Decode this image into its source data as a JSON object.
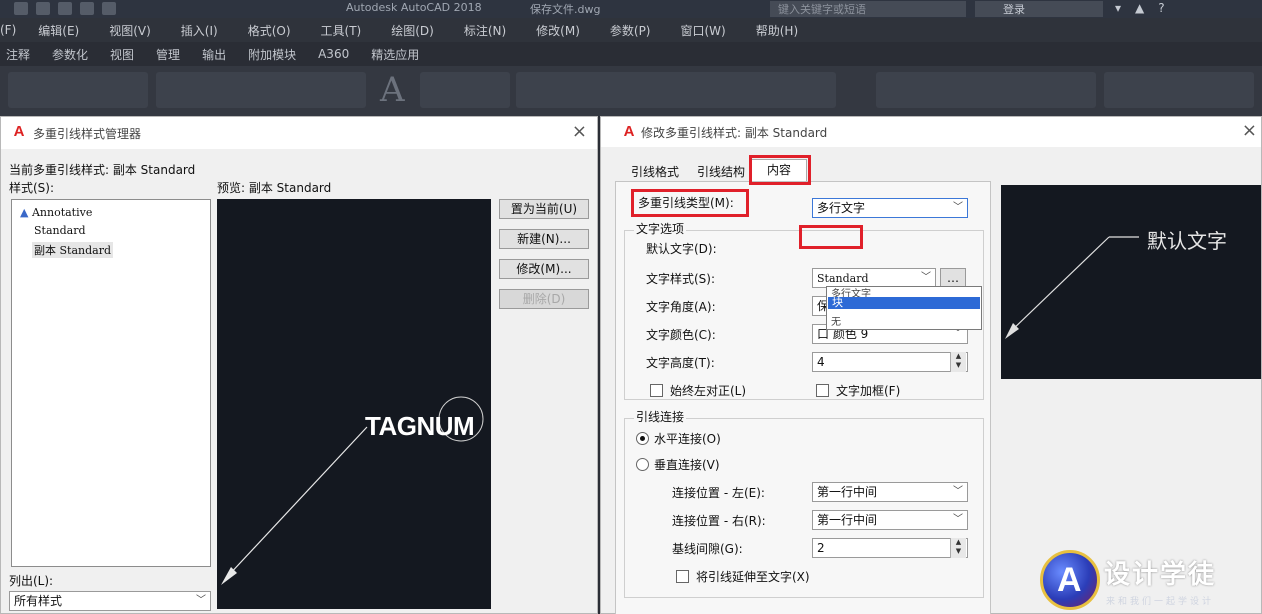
{
  "titlebar": {
    "app_title": "Autodesk AutoCAD 2018",
    "doc_title": "保存文件.dwg",
    "search_placeholder": "键入关键字或短语",
    "login_label": "登录"
  },
  "menubar": {
    "items": [
      "(F)",
      "编辑(E)",
      "视图(V)",
      "插入(I)",
      "格式(O)",
      "工具(T)",
      "绘图(D)",
      "标注(N)",
      "修改(M)",
      "参数(P)",
      "窗口(W)",
      "帮助(H)"
    ]
  },
  "ribbon_tabs": {
    "items": [
      "注释",
      "参数化",
      "视图",
      "管理",
      "输出",
      "附加模块",
      "A360",
      "精选应用"
    ]
  },
  "left_dialog": {
    "title": "多重引线样式管理器",
    "current_style": "当前多重引线样式: 副本 Standard",
    "styles_label": "样式(S):",
    "preview_label": "预览: 副本 Standard",
    "styles": [
      "Annotative",
      "Standard",
      "副本 Standard"
    ],
    "preview_text": "TAGNUM",
    "buttons": {
      "set_current": "置为当前(U)",
      "new": "新建(N)...",
      "modify": "修改(M)...",
      "delete": "删除(D)"
    },
    "list_label": "列出(L):",
    "list_value": "所有样式"
  },
  "right_dialog": {
    "title": "修改多重引线样式: 副本 Standard",
    "tabs": [
      "引线格式",
      "引线结构",
      "内容"
    ],
    "leader_type_label": "多重引线类型(M):",
    "leader_type_value": "多行文字",
    "dropdown_options": [
      "多行文字",
      "块",
      "无"
    ],
    "text_options_group": "文字选项",
    "default_text_label": "默认文字(D):",
    "text_style_label": "文字样式(S):",
    "text_style_value": "Standard",
    "text_angle_label": "文字角度(A):",
    "text_angle_value": "保持水平",
    "text_color_label": "文字颜色(C):",
    "text_color_value": "口 颜色 9",
    "text_height_label": "文字高度(T):",
    "text_height_value": "4",
    "always_left_label": "始终左对正(L)",
    "text_frame_label": "文字加框(F)",
    "leader_connection_group": "引线连接",
    "horizontal_label": "水平连接(O)",
    "vertical_label": "垂直连接(V)",
    "attach_left_label": "连接位置 - 左(E):",
    "attach_left_value": "第一行中间",
    "attach_right_label": "连接位置 - 右(R):",
    "attach_right_value": "第一行中间",
    "landing_gap_label": "基线间隙(G):",
    "landing_gap_value": "2",
    "extend_label": "将引线延伸至文字(X)",
    "preview_text": "默认文字"
  },
  "watermark": {
    "logo_letter": "A",
    "name": "设计学徒",
    "slogan": "来和我们一起学设计"
  },
  "colors": {
    "highlight_red": "#e0202a",
    "selection_blue": "#2d6ad6",
    "preview_bg": "#141820"
  }
}
